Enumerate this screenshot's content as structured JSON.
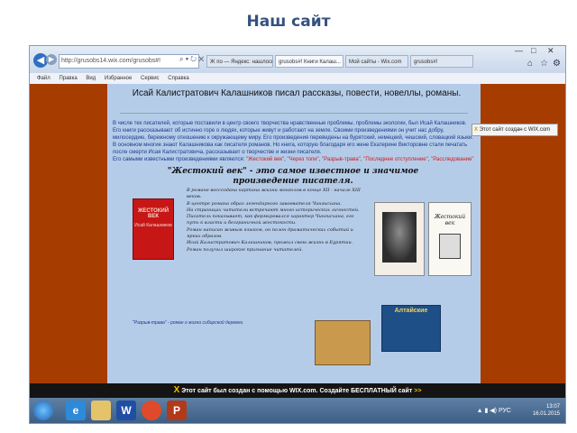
{
  "slide_title": "Наш сайт",
  "browser": {
    "address": "http://grusobs14.wix.com/grusobs#!",
    "tabs": [
      "Ж по — Яндекс: нашлось 6 ре...",
      "grusobs#! Книги Калаш...",
      "Мой сайты - Wix.com",
      "grusobs#!"
    ],
    "window_controls": [
      "—",
      "□",
      "✕"
    ],
    "menu": [
      "Файл",
      "Правка",
      "Вид",
      "Избранное",
      "Сервис",
      "Справка"
    ],
    "wix_top_label": "Этот сайт создан с WIX.com"
  },
  "page": {
    "title": "Исай Калистратович Калашников писал рассказы, повести, новеллы, романы.",
    "intro": [
      "В числе тех писателей, которые поставили в центр своего творчества нравственные проблемы, проблемы экологии, был Исай Калашников.",
      "Его книги рассказывают об истинно горе о людях, которые живут и работают на земле. Своими произведениями он учит нас добру, милосердию, бережному отношению к окружающему миру. Его произведения переведены на бурятский, немецкий, чешский, словацкий языки.",
      "В основном многие знают Калашникова как писателя романов. Но книга, которую благодаря его жене Екатерине Викторовне стали печатать после смерти Исая Калистратовича, рассказывает о творчестве и жизни писателя."
    ],
    "works_intro": "Его самыми известными произведениями являются:",
    "works": [
      "\"Жестокий век\"",
      "\"Через топи\"",
      "\"Разрыв-трава\"",
      "\"Последнее отступление\"",
      "\"Расследование\""
    ],
    "section_title": "\"Жестокий век\" - это самое известное и значимое произведение писателя.",
    "book_cover_title": "ЖЕСТОКИЙ ВЕК",
    "book_cover_author": "Исай Калашников",
    "description": [
      "В романе воссоздана картина жизни монголов в конце XII - начале XIII веков.",
      "В центре романа образ легендарного завоевателя Чингисхана.",
      "На страницах читатели встречают много исторических личностей.",
      "Писатель показывает, как формировался характер Чингисхана, его путь к власти и безграничной жестокости.",
      "Роман написан живым языком, он полон драматических событий и ярких образов.",
      "Исай Калистратович Калашников, прожил свою жизнь в Бурятии. Роман получил широкое признание читателей."
    ],
    "booklet_title": "Жестокий век",
    "bottom_text": "\"Разрыв-трава\" - роман о жизни сибирской деревни",
    "bottom_book_title": "Алтайские"
  },
  "wix_banner": {
    "text": "Этот сайт был создан с помощью WIX.com. Создайте БЕСПЛАТНЫЙ сайт",
    "arrow": ">>"
  },
  "taskbar": {
    "lang": "РУС",
    "time": "13:07",
    "date": "16.01.2015"
  }
}
